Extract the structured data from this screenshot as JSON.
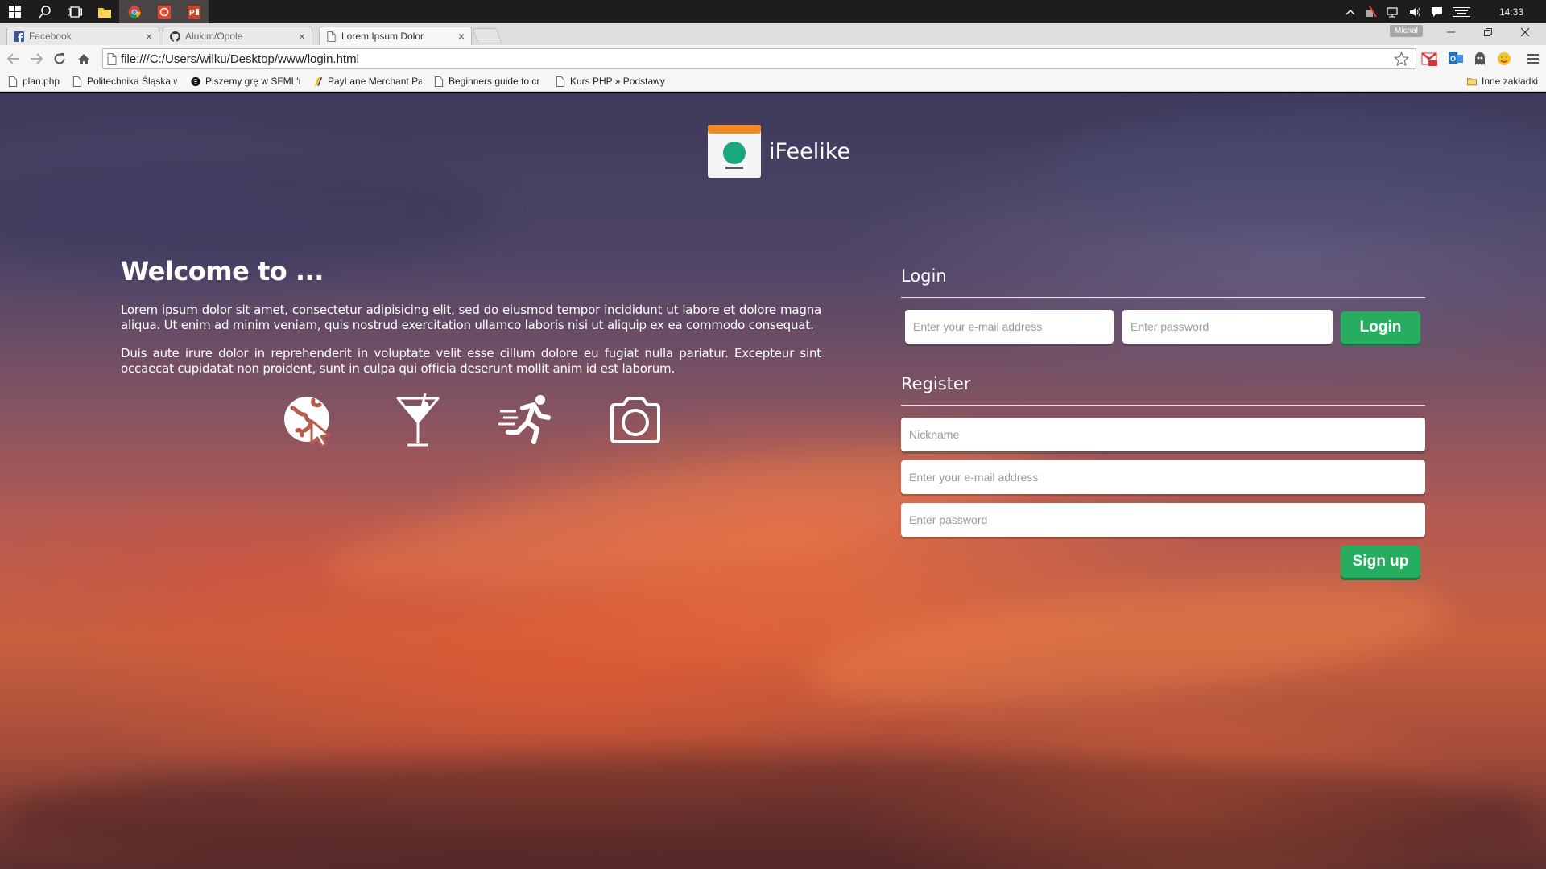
{
  "taskbar": {
    "clock": "14:33"
  },
  "browser": {
    "tabs": [
      {
        "label": "Facebook"
      },
      {
        "label": "Alukim/Opole"
      },
      {
        "label": "Lorem Ipsum Dolor"
      }
    ],
    "profile_name": "Michał",
    "url": "file:///C:/Users/wilku/Desktop/www/login.html",
    "bookmarks": [
      {
        "label": "plan.php"
      },
      {
        "label": "Politechnika Śląska w"
      },
      {
        "label": "Piszemy grę w SFML'u"
      },
      {
        "label": "PayLane Merchant Pa"
      },
      {
        "label": "Beginners guide to cr"
      },
      {
        "label": "Kurs PHP » Podstawy"
      }
    ],
    "other_bookmarks": "Inne zakładki"
  },
  "page": {
    "brand": {
      "name": "iFeelike"
    },
    "welcome": {
      "title": "Welcome to ...",
      "paragraph1": "Lorem ipsum dolor sit amet, consectetur adipisicing elit, sed do eiusmod tempor incididunt ut labore et dolore magna aliqua. Ut enim ad minim veniam, quis nostrud exercitation ullamco laboris nisi ut aliquip ex ea commodo consequat.",
      "paragraph2": "Duis aute irure dolor in reprehenderit in voluptate velit esse cillum dolore eu fugiat nulla pariatur. Excepteur sint occaecat cupidatat non proident, sunt in culpa qui officia deserunt mollit anim id est laborum."
    },
    "features": [
      "globe-cursor-icon",
      "cocktail-icon",
      "running-icon",
      "camera-icon"
    ],
    "login": {
      "title": "Login",
      "email_placeholder": "Enter your e-mail address",
      "password_placeholder": "Enter password",
      "button": "Login"
    },
    "register": {
      "title": "Register",
      "nickname_placeholder": "Nickname",
      "email_placeholder": "Enter your e-mail address",
      "password_placeholder": "Enter password",
      "button": "Sign up"
    }
  },
  "colors": {
    "accent_button": "#26ad5f",
    "brand_logo_top": "#f08a24",
    "brand_logo_dot": "#1aa67f"
  }
}
